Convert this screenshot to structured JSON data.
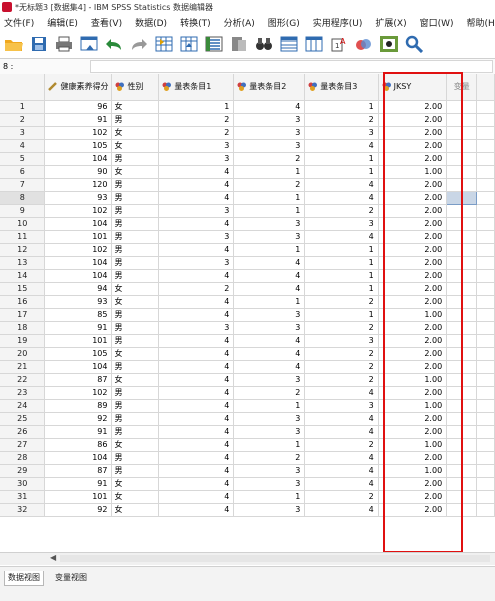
{
  "window": {
    "title": "*无标题3 [数据集4] - IBM SPSS Statistics 数据编辑器"
  },
  "menu": [
    "文件(F)",
    "编辑(E)",
    "查看(V)",
    "数据(D)",
    "转换(T)",
    "分析(A)",
    "图形(G)",
    "实用程序(U)",
    "扩展(X)",
    "窗口(W)",
    "帮助(H)"
  ],
  "cell_editor": {
    "ref": "8 :",
    "value": ""
  },
  "columns": [
    "健康素养得分",
    "性别",
    "量表条目1",
    "量表条目2",
    "量表条目3",
    "JKSY",
    "变量"
  ],
  "rows": [
    [
      96,
      "女",
      1,
      4,
      1,
      "2.00"
    ],
    [
      91,
      "男",
      2,
      3,
      2,
      "2.00"
    ],
    [
      102,
      "女",
      2,
      3,
      3,
      "2.00"
    ],
    [
      105,
      "女",
      3,
      3,
      4,
      "2.00"
    ],
    [
      104,
      "男",
      3,
      2,
      1,
      "2.00"
    ],
    [
      90,
      "女",
      4,
      1,
      1,
      "1.00"
    ],
    [
      120,
      "男",
      4,
      2,
      4,
      "2.00"
    ],
    [
      93,
      "男",
      4,
      1,
      4,
      "2.00"
    ],
    [
      102,
      "男",
      3,
      1,
      2,
      "2.00"
    ],
    [
      104,
      "男",
      4,
      3,
      3,
      "2.00"
    ],
    [
      101,
      "男",
      3,
      3,
      4,
      "2.00"
    ],
    [
      102,
      "男",
      4,
      1,
      1,
      "2.00"
    ],
    [
      104,
      "男",
      3,
      4,
      1,
      "2.00"
    ],
    [
      104,
      "男",
      4,
      4,
      1,
      "2.00"
    ],
    [
      94,
      "女",
      2,
      4,
      1,
      "2.00"
    ],
    [
      93,
      "女",
      4,
      1,
      2,
      "2.00"
    ],
    [
      85,
      "男",
      4,
      3,
      1,
      "1.00"
    ],
    [
      91,
      "男",
      3,
      3,
      2,
      "2.00"
    ],
    [
      101,
      "男",
      4,
      4,
      3,
      "2.00"
    ],
    [
      105,
      "女",
      4,
      4,
      2,
      "2.00"
    ],
    [
      104,
      "男",
      4,
      4,
      2,
      "2.00"
    ],
    [
      87,
      "女",
      4,
      3,
      2,
      "1.00"
    ],
    [
      102,
      "男",
      4,
      2,
      4,
      "2.00"
    ],
    [
      89,
      "男",
      4,
      1,
      3,
      "1.00"
    ],
    [
      92,
      "男",
      4,
      3,
      4,
      "2.00"
    ],
    [
      91,
      "男",
      4,
      3,
      4,
      "2.00"
    ],
    [
      86,
      "女",
      4,
      1,
      2,
      "1.00"
    ],
    [
      104,
      "男",
      4,
      2,
      4,
      "2.00"
    ],
    [
      87,
      "男",
      4,
      3,
      4,
      "1.00"
    ],
    [
      91,
      "女",
      4,
      3,
      4,
      "2.00"
    ],
    [
      101,
      "女",
      4,
      1,
      2,
      "2.00"
    ],
    [
      92,
      "女",
      4,
      3,
      4,
      "2.00"
    ]
  ],
  "tabs": {
    "data_view": "数据视图",
    "variable_view": "变量视图"
  },
  "colors": {
    "highlight_box": "#e01010",
    "selected_cell": "#c9d6e6"
  }
}
